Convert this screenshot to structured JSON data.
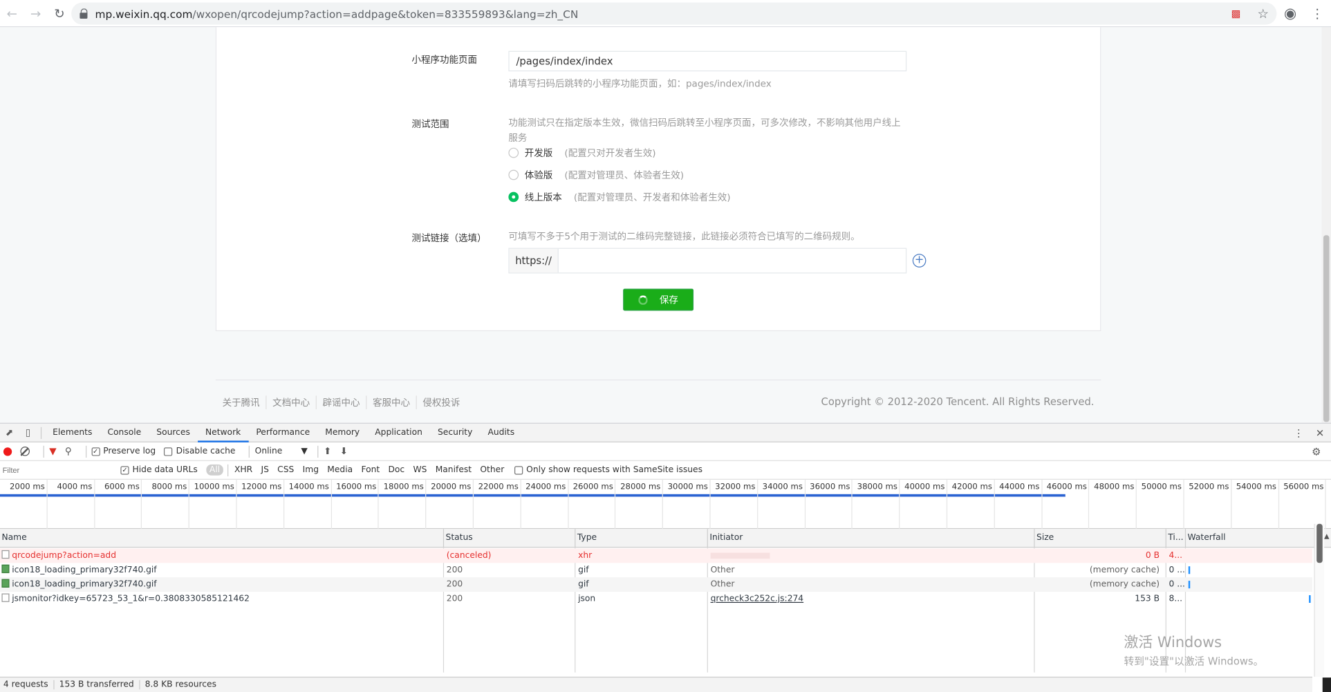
{
  "browser": {
    "url_host": "mp.weixin.qq.com",
    "url_rest": "/wxopen/qrcodejump?action=addpage&token=833559893&lang=zh_CN",
    "icons": [
      "back-icon",
      "forward-icon",
      "reload-icon",
      "lock-icon",
      "extension-icon",
      "star-icon",
      "profile-icon",
      "menu-icon"
    ]
  },
  "form": {
    "page_label": "小程序功能页面",
    "page_value": "/pages/index/index",
    "page_hint": "请填写扫码后跳转的小程序功能页面，如：pages/index/index",
    "scope_label": "测试范围",
    "scope_hint": "功能测试只在指定版本生效，微信扫码后跳转至小程序页面，可多次修改，不影响其他用户线上服务",
    "options": [
      {
        "name": "开发版",
        "desc": "(配置只对开发者生效)",
        "selected": false
      },
      {
        "name": "体验版",
        "desc": "(配置对管理员、体验者生效)",
        "selected": false
      },
      {
        "name": "线上版本",
        "desc": "(配置对管理员、开发者和体验者生效)",
        "selected": true
      }
    ],
    "link_label": "测试链接（选填）",
    "link_hint": "可填写不多于5个用于测试的二维码完整链接，此链接必须符合已填写的二维码规则。",
    "link_prefix": "https://",
    "link_value": "",
    "save_label": "保存"
  },
  "footer": {
    "links": [
      "关于腾讯",
      "文档中心",
      "辟谣中心",
      "客服中心",
      "侵权投诉"
    ],
    "copyright": "Copyright © 2012-2020 Tencent. All Rights Reserved."
  },
  "devtools": {
    "tabs": [
      "Elements",
      "Console",
      "Sources",
      "Network",
      "Performance",
      "Memory",
      "Application",
      "Security",
      "Audits"
    ],
    "active_tab": "Network",
    "preserve_log": "Preserve log",
    "disable_cache": "Disable cache",
    "throttle": "Online",
    "filter_placeholder": "Filter",
    "hide_data_urls": "Hide data URLs",
    "types": [
      "All",
      "XHR",
      "JS",
      "CSS",
      "Img",
      "Media",
      "Font",
      "Doc",
      "WS",
      "Manifest",
      "Other"
    ],
    "samesite": "Only show requests with SameSite issues",
    "ticks": [
      "2000 ms",
      "4000 ms",
      "6000 ms",
      "8000 ms",
      "10000 ms",
      "12000 ms",
      "14000 ms",
      "16000 ms",
      "18000 ms",
      "20000 ms",
      "22000 ms",
      "24000 ms",
      "26000 ms",
      "28000 ms",
      "30000 ms",
      "32000 ms",
      "34000 ms",
      "36000 ms",
      "38000 ms",
      "40000 ms",
      "42000 ms",
      "44000 ms",
      "46000 ms",
      "48000 ms",
      "50000 ms",
      "52000 ms",
      "54000 ms",
      "56000 ms"
    ],
    "columns": [
      "Name",
      "Status",
      "Type",
      "Initiator",
      "Size",
      "Ti...",
      "Waterfall"
    ],
    "requests": [
      {
        "name": "qrcodejump?action=add",
        "status": "(canceled)",
        "type": "xhr",
        "initiator": "",
        "size": "0 B",
        "time": "4..."
      },
      {
        "name": "icon18_loading_primary32f740.gif",
        "status": "200",
        "type": "gif",
        "initiator": "Other",
        "size": "(memory cache)",
        "time": "0 ..."
      },
      {
        "name": "icon18_loading_primary32f740.gif",
        "status": "200",
        "type": "gif",
        "initiator": "Other",
        "size": "(memory cache)",
        "time": "0 ..."
      },
      {
        "name": "jsmonitor?idkey=65723_53_1&r=0.3808330585121462",
        "status": "200",
        "type": "json",
        "initiator": "qrcheck3c252c.js:274",
        "size": "153 B",
        "time": "8..."
      }
    ],
    "summary": [
      "4 requests",
      "153 B transferred",
      "8.8 KB resources"
    ]
  },
  "watermark": {
    "line1": "激活 Windows",
    "line2": "转到\"设置\"以激活 Windows。"
  }
}
